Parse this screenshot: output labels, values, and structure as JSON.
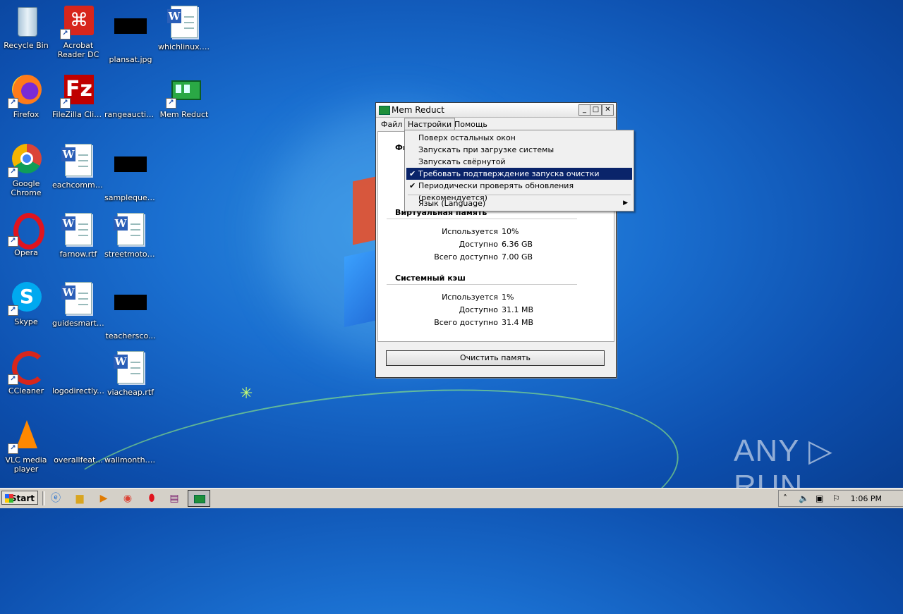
{
  "desktop": {
    "icons": [
      {
        "label": "Recycle Bin"
      },
      {
        "label": "Acrobat Reader DC"
      },
      {
        "label": "plansat.jpg"
      },
      {
        "label": "whichlinux.rtf"
      },
      {
        "label": "Firefox"
      },
      {
        "label": "FileZilla Client"
      },
      {
        "label": "rangeauctio..."
      },
      {
        "label": "Mem Reduct"
      },
      {
        "label": "Google Chrome"
      },
      {
        "label": "eachcommis..."
      },
      {
        "label": "sampleques..."
      },
      {
        "label": "Opera"
      },
      {
        "label": "farnow.rtf"
      },
      {
        "label": "streetmotor..."
      },
      {
        "label": "Skype"
      },
      {
        "label": "guidesmarti..."
      },
      {
        "label": "teachersco..."
      },
      {
        "label": "CCleaner"
      },
      {
        "label": "logodirectly...."
      },
      {
        "label": "viacheap.rtf"
      },
      {
        "label": "VLC media player"
      },
      {
        "label": "overallfeat..."
      },
      {
        "label": "wallmonth.png"
      }
    ]
  },
  "window": {
    "title": "Mem Reduct",
    "menu": [
      "Файл",
      "Настройки",
      "Помощь"
    ],
    "section_physical_partial": "Фи",
    "virtual": {
      "title": "Виртуальная память",
      "rows": [
        {
          "k": "Используется",
          "v": "10%"
        },
        {
          "k": "Доступно",
          "v": "6.36 GB"
        },
        {
          "k": "Всего доступно",
          "v": "7.00 GB"
        }
      ]
    },
    "cache": {
      "title": "Системный кэш",
      "rows": [
        {
          "k": "Используется",
          "v": "1%"
        },
        {
          "k": "Доступно",
          "v": "31.1 MB"
        },
        {
          "k": "Всего доступно",
          "v": "31.4 MB"
        }
      ]
    },
    "clean_button": "Очистить память"
  },
  "dropdown": {
    "items": [
      {
        "label": "Поверх остальных окон",
        "checked": false
      },
      {
        "label": "Запускать при загрузке системы",
        "checked": false
      },
      {
        "label": "Запускать свёрнутой",
        "checked": false
      },
      {
        "label": "Требовать подтверждение запуска очистки",
        "checked": true
      },
      {
        "label": "Периодически проверять обновления (рекомендуется)",
        "checked": true
      }
    ],
    "language": "Язык (Language)",
    "check": "✔",
    "submenu_arrow": "▶"
  },
  "taskbar": {
    "start": "Start",
    "clock": "1:06 PM"
  },
  "watermark": "ANY ▷ RUN"
}
